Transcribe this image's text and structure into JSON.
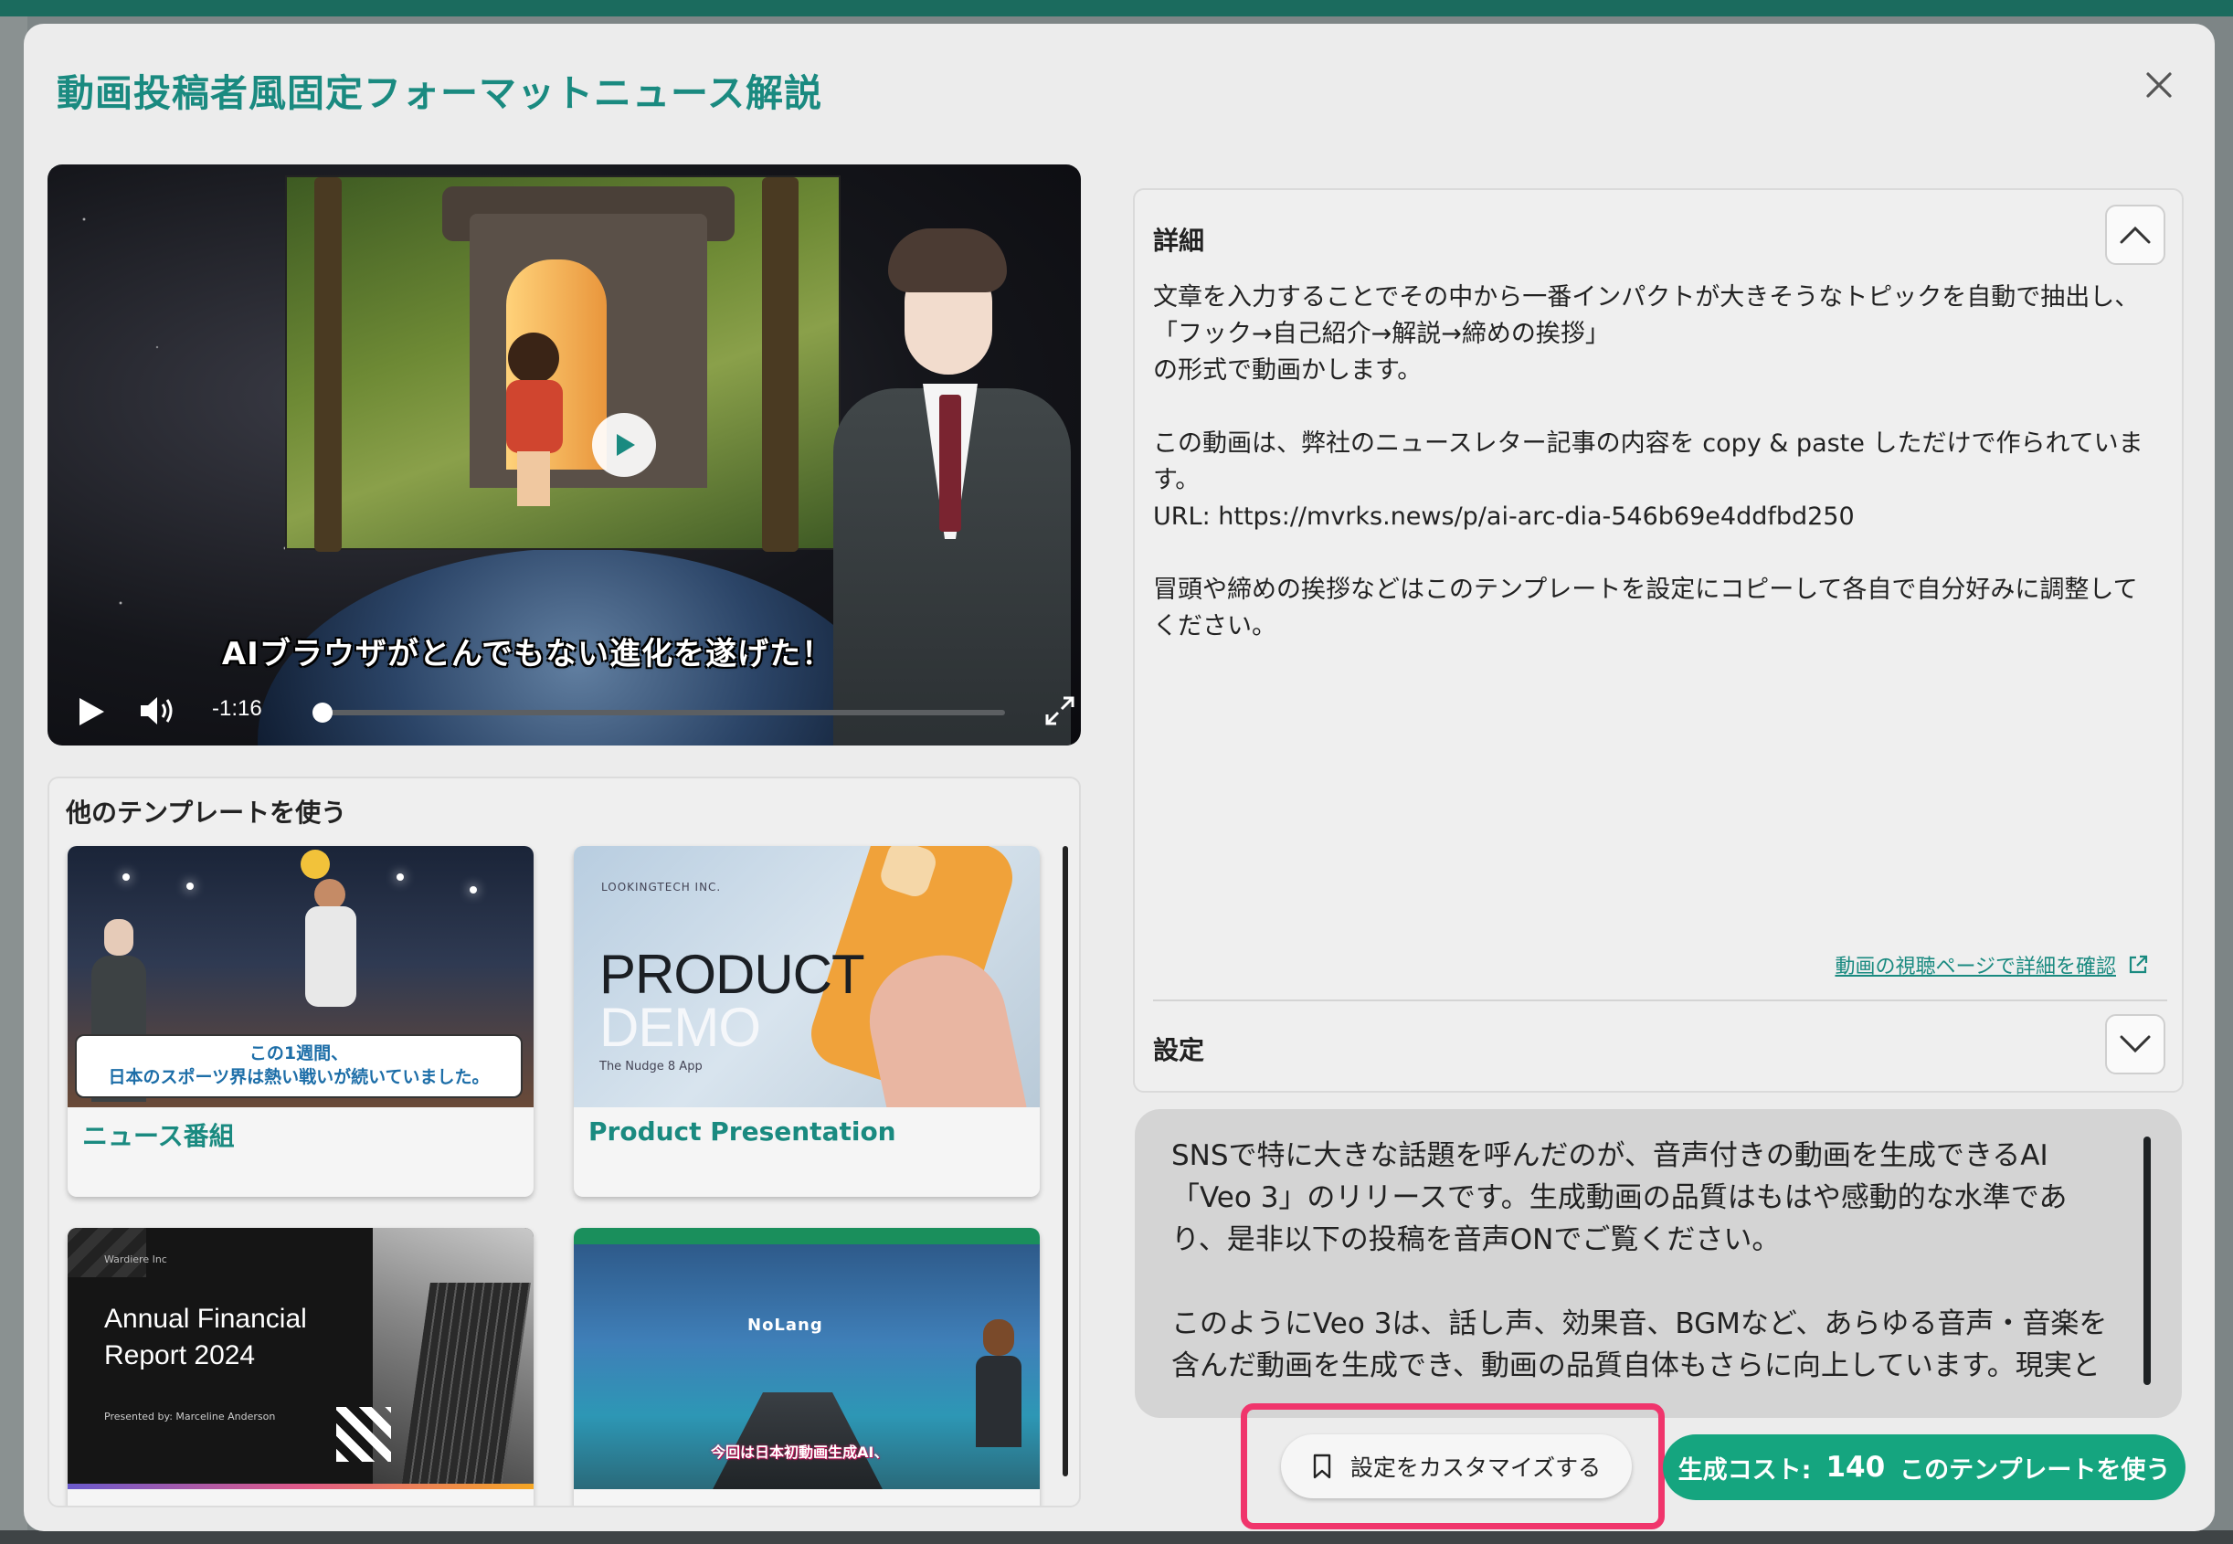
{
  "modal": {
    "title": "動画投稿者風固定フォーマットニュース解説"
  },
  "video": {
    "caption": "AIブラウザがとんでもない進化を遂げた！",
    "time_remaining": "-1:16",
    "progress": 0.0
  },
  "templates": {
    "title": "他のテンプレートを使う",
    "items": [
      {
        "label": "ニュース番組",
        "thumb_caption_line1": "この1週間、",
        "thumb_caption_line2": "日本のスポーツ界は熱い戦いが続いていました。"
      },
      {
        "label": "Product Presentation",
        "thumb_brand": "LOOKINGTECH INC.",
        "thumb_title_line1": "PRODUCT",
        "thumb_title_line2": "DEMO",
        "thumb_subtitle": "The Nudge 8 App"
      },
      {
        "thumb_brand": "Wardiere Inc",
        "thumb_title_line1": "Annual Financial",
        "thumb_title_line2": "Report 2024",
        "thumb_presenter": "Presented by: Marceline Anderson"
      },
      {
        "thumb_brand": "NoLang",
        "thumb_caption": "今回は日本初動画生成AI、"
      }
    ]
  },
  "details": {
    "label": "詳細",
    "para1_line1": "文章を入力することでその中から一番インパクトが大きそうなトピックを自動で抽出し、",
    "para1_line2": "「フック→自己紹介→解説→締めの挨拶」",
    "para1_line3": "の形式で動画かします。",
    "para2_line1": "この動画は、弊社のニュースレター記事の内容を copy & paste しただけで作られています。",
    "para2_line2": "URL: https://mvrks.news/p/ai-arc-dia-546b69e4ddfbd250",
    "para3": "冒頭や締めの挨拶などはこのテンプレートを設定にコピーして各自で自分好みに調整してください。",
    "link_text": "動画の視聴ページで詳細を確認"
  },
  "settings": {
    "label": "設定",
    "text_para1": "SNSで特に大きな話題を呼んだのが、音声付きの動画を生成できるAI「Veo 3」のリリースです。生成動画の品質はもはや感動的な水準であり、是非以下の投稿を音声ONでご覧ください。",
    "text_para2": "このようにVeo 3は、話し声、効果音、BGMなど、あらゆる音声・音楽を含んだ動画を生成でき、動画の品質自体もさらに向上しています。現実と"
  },
  "actions": {
    "customize_label": "設定をカスタマイズする",
    "cost_label": "生成コスト:",
    "cost_value": "140",
    "use_label": "このテンプレートを使う"
  },
  "colors": {
    "accent": "#1a8a80",
    "primary_button": "#15a57f",
    "highlight": "#f0356c"
  }
}
